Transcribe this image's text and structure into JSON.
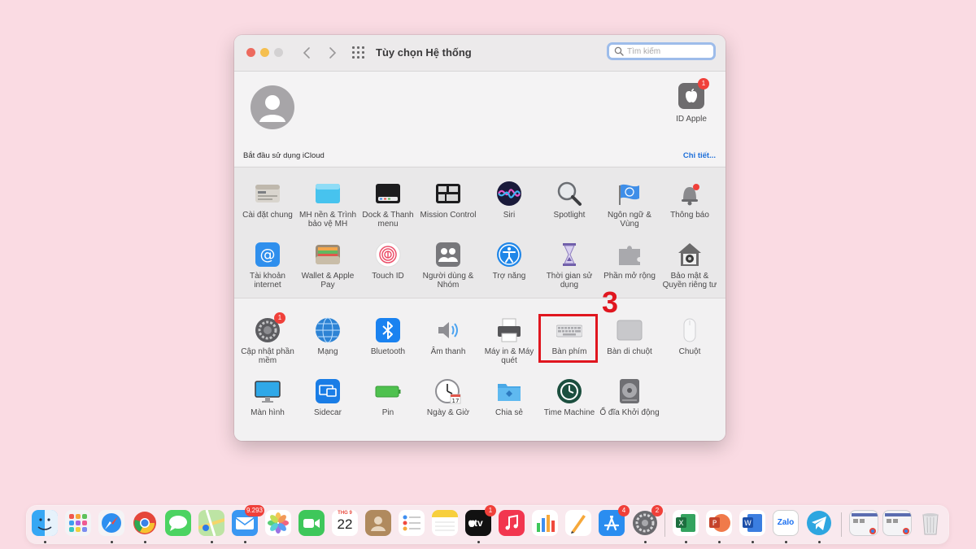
{
  "window": {
    "title": "Tùy chọn Hệ thống",
    "search_placeholder": "Tìm kiếm"
  },
  "account": {
    "apple_id_label": "ID Apple",
    "apple_id_badge": "1",
    "icloud_text": "Bắt đầu sử dụng iCloud",
    "details_link": "Chi tiết..."
  },
  "prefs_row1": [
    {
      "label": "Cài đặt chung",
      "icon": "general-icon"
    },
    {
      "label": "MH nền & Trình bảo vệ MH",
      "icon": "desktop-screensaver-icon"
    },
    {
      "label": "Dock & Thanh menu",
      "icon": "dock-menubar-icon"
    },
    {
      "label": "Mission Control",
      "icon": "mission-control-icon"
    },
    {
      "label": "Siri",
      "icon": "siri-icon"
    },
    {
      "label": "Spotlight",
      "icon": "spotlight-icon"
    },
    {
      "label": "Ngôn ngữ & Vùng",
      "icon": "language-region-icon"
    },
    {
      "label": "Thông báo",
      "icon": "notifications-icon"
    }
  ],
  "prefs_row2": [
    {
      "label": "Tài khoản internet",
      "icon": "internet-accounts-icon"
    },
    {
      "label": "Wallet & Apple Pay",
      "icon": "wallet-icon"
    },
    {
      "label": "Touch ID",
      "icon": "touch-id-icon"
    },
    {
      "label": "Người dùng & Nhóm",
      "icon": "users-groups-icon"
    },
    {
      "label": "Trợ năng",
      "icon": "accessibility-icon"
    },
    {
      "label": "Thời gian sử dụng",
      "icon": "screen-time-icon"
    },
    {
      "label": "Phần mở rộng",
      "icon": "extensions-icon"
    },
    {
      "label": "Bảo mật & Quyền riêng tư",
      "icon": "security-privacy-icon"
    }
  ],
  "prefs_row3": [
    {
      "label": "Cập nhật phần mềm",
      "icon": "software-update-icon",
      "badge": "1"
    },
    {
      "label": "Mạng",
      "icon": "network-icon"
    },
    {
      "label": "Bluetooth",
      "icon": "bluetooth-icon"
    },
    {
      "label": "Âm thanh",
      "icon": "sound-icon"
    },
    {
      "label": "Máy in & Máy quét",
      "icon": "printers-scanners-icon"
    },
    {
      "label": "Bàn phím",
      "icon": "keyboard-icon"
    },
    {
      "label": "Bàn di chuột",
      "icon": "trackpad-icon"
    },
    {
      "label": "Chuột",
      "icon": "mouse-icon"
    }
  ],
  "prefs_row4": [
    {
      "label": "Màn hình",
      "icon": "displays-icon"
    },
    {
      "label": "Sidecar",
      "icon": "sidecar-icon"
    },
    {
      "label": "Pin",
      "icon": "battery-icon"
    },
    {
      "label": "Ngày & Giờ",
      "icon": "date-time-icon"
    },
    {
      "label": "Chia sẻ",
      "icon": "sharing-icon"
    },
    {
      "label": "Time Machine",
      "icon": "time-machine-icon"
    },
    {
      "label": "Ổ đĩa Khởi động",
      "icon": "startup-disk-icon"
    }
  ],
  "annotation": {
    "step_number": "3"
  },
  "dock": {
    "mail_badge": "9.293",
    "tv_badge": "1",
    "appstore_badge": "4",
    "settings_badge": "2",
    "calendar_month": "THG 9",
    "calendar_day": "22",
    "tv_text": "tv",
    "zalo_text": "Zalo"
  },
  "colors": {
    "desktop": "#fadbe3",
    "highlight": "#e0161f",
    "link": "#1e6fd9"
  }
}
